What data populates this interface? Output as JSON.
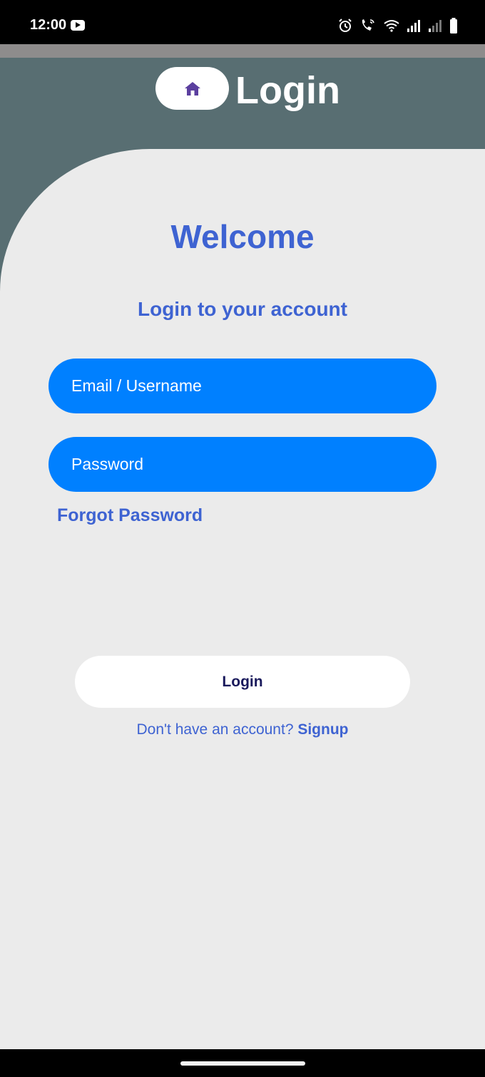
{
  "status_bar": {
    "time": "12:00",
    "icons": [
      "youtube-icon",
      "alarm-icon",
      "wifi-call-icon",
      "wifi-icon",
      "signal-icon",
      "signal-weak-icon",
      "battery-icon"
    ]
  },
  "header": {
    "title": "Login",
    "home_icon": "home-icon",
    "background_color": "#586e72"
  },
  "main": {
    "welcome": "Welcome",
    "subtitle": "Login to your account",
    "email_placeholder": "Email / Username",
    "password_placeholder": "Password",
    "forgot_password": "Forgot Password",
    "login_button": "Login",
    "signup_prompt": "Don't have an account?",
    "signup_link": "Signup"
  },
  "colors": {
    "accent": "#3e63d2",
    "input": "#0080ff",
    "background": "#ebebeb"
  }
}
